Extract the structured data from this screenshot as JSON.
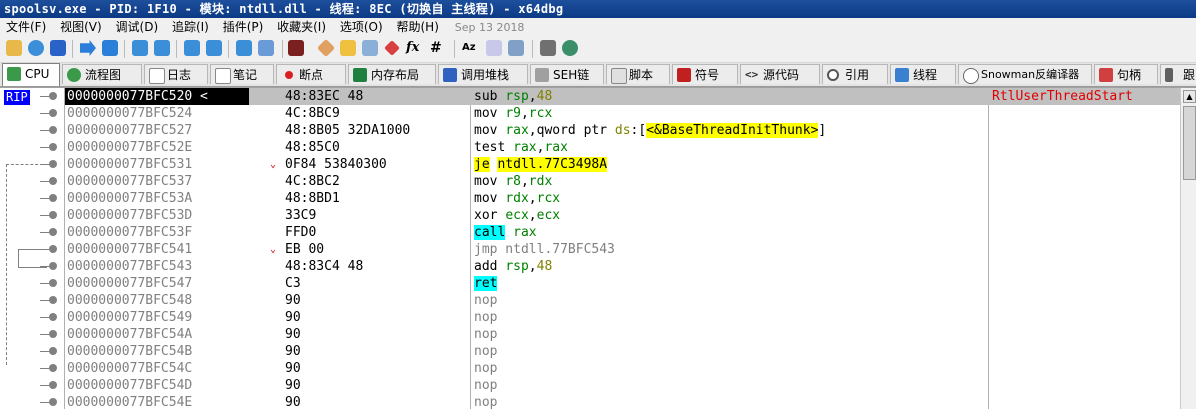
{
  "window": {
    "title": "spoolsv.exe - PID: 1F10 - 模块: ntdll.dll - 线程: 8EC (切换自 主线程) - x64dbg"
  },
  "menu": {
    "items": [
      "文件(F)",
      "视图(V)",
      "调试(D)",
      "追踪(I)",
      "插件(P)",
      "收藏夹(I)",
      "选项(O)",
      "帮助(H)"
    ],
    "date": "Sep 13 2018"
  },
  "tabs": [
    {
      "label": "CPU",
      "icon": "cpu-icon"
    },
    {
      "label": "流程图",
      "icon": "graph-icon"
    },
    {
      "label": "日志",
      "icon": "log-icon"
    },
    {
      "label": "笔记",
      "icon": "notes-icon"
    },
    {
      "label": "断点",
      "icon": "breakpoint-icon"
    },
    {
      "label": "内存布局",
      "icon": "memory-map-icon"
    },
    {
      "label": "调用堆栈",
      "icon": "call-stack-icon"
    },
    {
      "label": "SEH链",
      "icon": "seh-icon"
    },
    {
      "label": "脚本",
      "icon": "script-icon"
    },
    {
      "label": "符号",
      "icon": "symbols-icon"
    },
    {
      "label": "源代码",
      "icon": "source-icon"
    },
    {
      "label": "引用",
      "icon": "references-icon"
    },
    {
      "label": "线程",
      "icon": "threads-icon"
    },
    {
      "label": "Snowman反编译器",
      "icon": "snowman-icon"
    },
    {
      "label": "句柄",
      "icon": "handles-icon"
    },
    {
      "label": "跟",
      "icon": "trace-icon"
    }
  ],
  "disasm": {
    "rip_label": "RIP",
    "current_marker": "<",
    "comment": "RtlUserThreadStart",
    "rows": [
      {
        "addr": "0000000077BFC520",
        "bytes": "48:83EC 48",
        "ins": "sub rsp,48"
      },
      {
        "addr": "0000000077BFC524",
        "bytes": "4C:8BC9",
        "ins": "mov r9,rcx"
      },
      {
        "addr": "0000000077BFC527",
        "bytes": "48:8B05 32DA1000",
        "ins": "mov rax,qword ptr ds:[<&BaseThreadInitThunk>]"
      },
      {
        "addr": "0000000077BFC52E",
        "bytes": "48:85C0",
        "ins": "test rax,rax"
      },
      {
        "addr": "0000000077BFC531",
        "bytes": "0F84 53840300",
        "ins": "je ntdll.77C3498A"
      },
      {
        "addr": "0000000077BFC537",
        "bytes": "4C:8BC2",
        "ins": "mov r8,rdx"
      },
      {
        "addr": "0000000077BFC53A",
        "bytes": "48:8BD1",
        "ins": "mov rdx,rcx"
      },
      {
        "addr": "0000000077BFC53D",
        "bytes": "33C9",
        "ins": "xor ecx,ecx"
      },
      {
        "addr": "0000000077BFC53F",
        "bytes": "FFD0",
        "ins": "call rax"
      },
      {
        "addr": "0000000077BFC541",
        "bytes": "EB 00",
        "ins": "jmp ntdll.77BFC543"
      },
      {
        "addr": "0000000077BFC543",
        "bytes": "48:83C4 48",
        "ins": "add rsp,48"
      },
      {
        "addr": "0000000077BFC547",
        "bytes": "C3",
        "ins": "ret"
      },
      {
        "addr": "0000000077BFC548",
        "bytes": "90",
        "ins": "nop"
      },
      {
        "addr": "0000000077BFC549",
        "bytes": "90",
        "ins": "nop"
      },
      {
        "addr": "0000000077BFC54A",
        "bytes": "90",
        "ins": "nop"
      },
      {
        "addr": "0000000077BFC54B",
        "bytes": "90",
        "ins": "nop"
      },
      {
        "addr": "0000000077BFC54C",
        "bytes": "90",
        "ins": "nop"
      },
      {
        "addr": "0000000077BFC54D",
        "bytes": "90",
        "ins": "nop"
      },
      {
        "addr": "0000000077BFC54E",
        "bytes": "90",
        "ins": "nop"
      }
    ]
  },
  "colors": {
    "register": "#008000",
    "number": "#808000",
    "jump_highlight": "#ffff00",
    "call_highlight": "#00ffff",
    "rip_background": "#0000ff",
    "comment": "#e00000"
  }
}
